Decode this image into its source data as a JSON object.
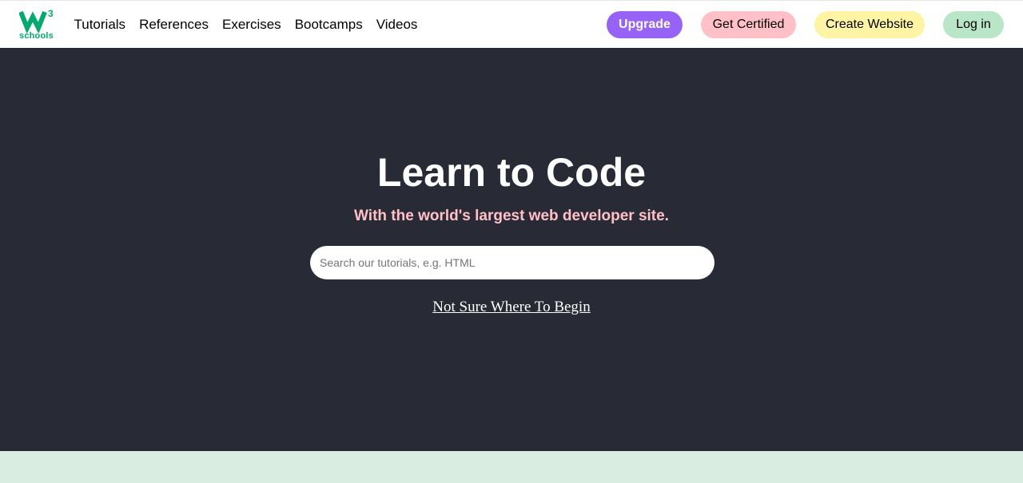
{
  "brand": {
    "logo_superscript": "3",
    "logo_text": "schools",
    "color": "#04AA6D"
  },
  "nav": {
    "links": [
      "Tutorials",
      "References",
      "Exercises",
      "Bootcamps",
      "Videos"
    ]
  },
  "actions": {
    "upgrade": "Upgrade",
    "get_certified": "Get Certified",
    "create_website": "Create Website",
    "login": "Log in"
  },
  "hero": {
    "title": "Learn to Code",
    "subtitle": "With the world's largest web developer site.",
    "search_placeholder": "Search our tutorials, e.g. HTML",
    "link": "Not Sure Where To Begin"
  },
  "colors": {
    "hero_bg": "#282a35",
    "subtitle": "#ffc0c7",
    "upgrade": "#9763f6",
    "certified": "#ffc0c7",
    "website": "#fff4a3",
    "login": "#b8e6c7",
    "band": "#d9eee1"
  }
}
